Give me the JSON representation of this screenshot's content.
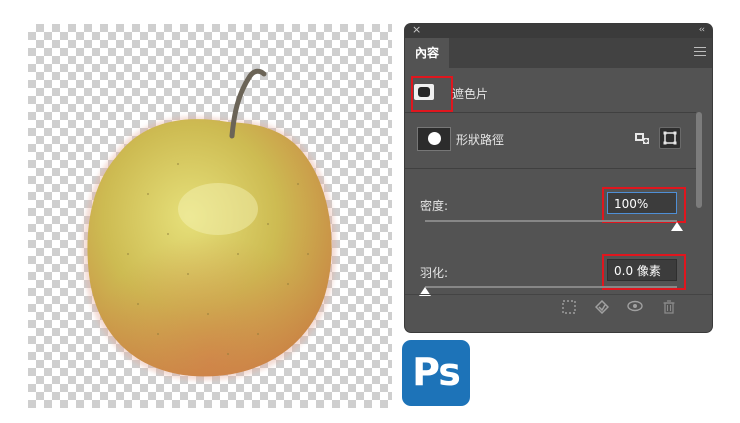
{
  "canvas": {
    "subject": "pear",
    "background": "transparency-checkerboard"
  },
  "panel": {
    "close_icon": "×",
    "collapse_icon": "‹‹",
    "tab_label": "內容",
    "menu_icon": "hamburger-icon",
    "mask_title": "遮色片",
    "shape_path_label": "形狀路徑",
    "density_label": "密度:",
    "density_value": "100%",
    "density_level": 1.0,
    "feather_label": "羽化:",
    "feather_value": "0.0 像素",
    "feather_level": 0.0,
    "footer_icons": [
      "selection-icon",
      "apply-mask-icon",
      "visibility-eye-icon",
      "trash-icon"
    ]
  },
  "logo": {
    "text": "Ps",
    "color": "#1d73b8"
  },
  "colors": {
    "panel_bg": "#535353",
    "highlight": "#e0161e"
  }
}
